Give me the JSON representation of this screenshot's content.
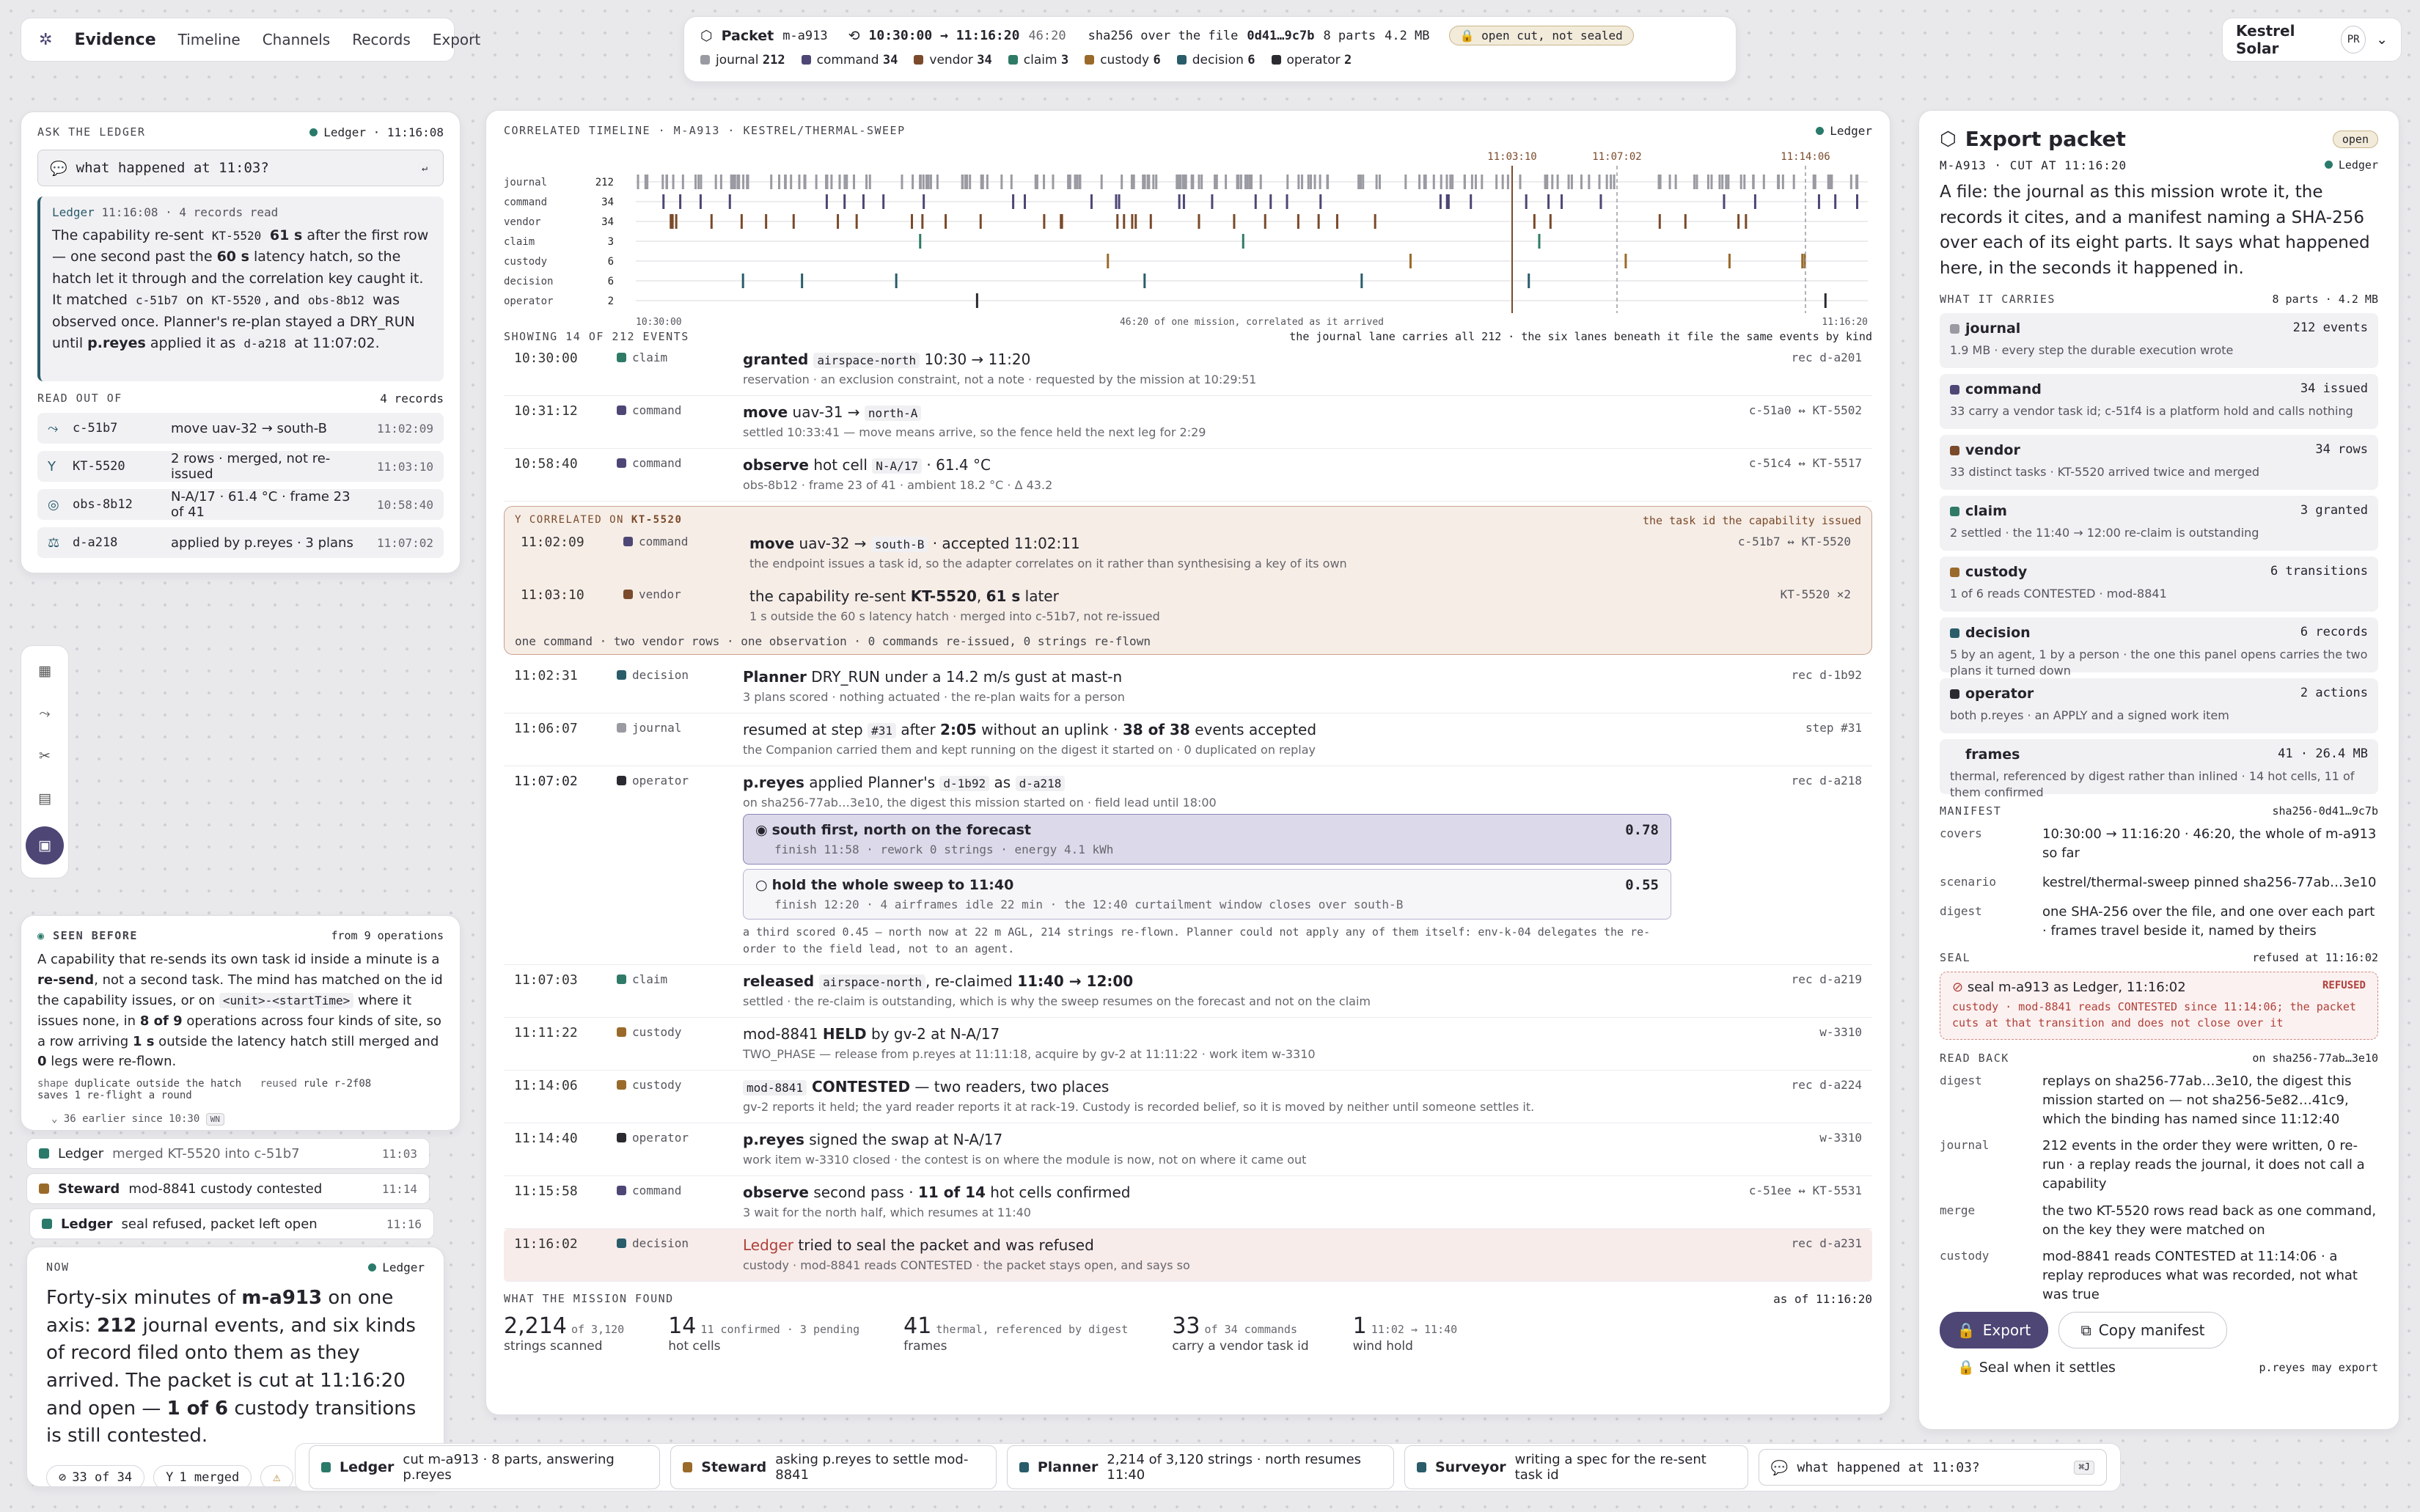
{
  "colors": {
    "journal": "#9a9aa2",
    "command": "#4e4675",
    "vendor": "#7a4a2a",
    "claim": "#2f7a66",
    "custody": "#9a6a2a",
    "decision": "#2a5c6a",
    "operator": "#2a2a30",
    "ledger": "#2a7a6a",
    "refused": "#b0403a"
  },
  "nav": {
    "brand": "Evidence",
    "items": [
      "Timeline",
      "Channels",
      "Records",
      "Export"
    ]
  },
  "packet": {
    "label": "Packet",
    "id": "m-a913",
    "range": "10:30:00 → 11:16:20",
    "dur": "46:20",
    "hash": "sha256 over the file",
    "hashval": "0d41…9c7b",
    "parts": "8 parts",
    "size": "4.2 MB",
    "badge": "open cut, not sealed",
    "counts": [
      {
        "k": "journal",
        "n": "212"
      },
      {
        "k": "command",
        "n": "34"
      },
      {
        "k": "vendor",
        "n": "34"
      },
      {
        "k": "claim",
        "n": "3"
      },
      {
        "k": "custody",
        "n": "6"
      },
      {
        "k": "decision",
        "n": "6"
      },
      {
        "k": "operator",
        "n": "2"
      }
    ]
  },
  "account": {
    "name": "Kestrel Solar",
    "initials": "PR"
  },
  "ask": {
    "title": "ASK THE LEDGER",
    "status": "Ledger · 11:16:08",
    "query": "what happened at 11:03?",
    "enter": "↵",
    "answer_meta_name": "Ledger",
    "answer_meta": "11:16:08 · 4 records read",
    "answer": [
      {
        "t": "The capability re-sent "
      },
      {
        "c": "KT-5520"
      },
      {
        "b": " 61 s"
      },
      {
        "t": " after the first row — one second past the "
      },
      {
        "b": "60 s"
      },
      {
        "t": " latency hatch, so the hatch let it through and the correlation key caught it. It matched "
      },
      {
        "c": "c-51b7"
      },
      {
        "t": " on "
      },
      {
        "c": "KT-5520"
      },
      {
        "t": ", and "
      },
      {
        "c": "obs-8b12"
      },
      {
        "t": " was observed once. Planner's re-plan stayed a DRY_RUN until "
      },
      {
        "b": "p.reyes"
      },
      {
        "t": " applied it as "
      },
      {
        "c": "d-a218"
      },
      {
        "t": " at 11:07:02."
      }
    ],
    "readout_title": "READ OUT OF",
    "readout_count": "4 records",
    "records": [
      {
        "icon": "⤳",
        "id": "c-51b7",
        "desc": "move uav-32 → south-B",
        "time": "11:02:09"
      },
      {
        "icon": "Y",
        "id": "KT-5520",
        "desc": "2 rows · merged, not re-issued",
        "time": "11:03:10"
      },
      {
        "icon": "◎",
        "id": "obs-8b12",
        "desc": "N-A/17 · 61.4 °C · frame 23 of 41",
        "time": "10:58:40"
      },
      {
        "icon": "⚖",
        "id": "d-a218",
        "desc": "applied by p.reyes · 3 plans",
        "time": "11:07:02"
      }
    ]
  },
  "seen": {
    "title": "SEEN BEFORE",
    "from": "from 9 operations",
    "body": [
      {
        "t": "A capability that re-sends its own task id inside a minute is a "
      },
      {
        "b": "re-send"
      },
      {
        "t": ", not a second task. The mind has matched on the id the capability issues, or on "
      },
      {
        "c": "<unit>-<startTime>"
      },
      {
        "t": " where it issues none, in "
      },
      {
        "b": "8 of 9"
      },
      {
        "t": " operations across four kinds of site, so a row arriving "
      },
      {
        "b": "1 s"
      },
      {
        "t": " outside the latency hatch still merged and "
      },
      {
        "b": "0"
      },
      {
        "t": " legs were re-flown."
      }
    ],
    "shape_k": "shape",
    "shape_v": "duplicate outside the hatch",
    "reused_k": "reused",
    "reused_v": "rule r-2f08",
    "saves": "saves 1 re-flight a round",
    "earlier": "36 earlier since 10:30",
    "earlier_key": "WN"
  },
  "stream": [
    {
      "name": "Ledger",
      "text": "merged KT-5520 into c-51b7",
      "time": "11:03",
      "color": "#2a7a6a"
    },
    {
      "name": "Steward",
      "text": "mod-8841 custody contested",
      "time": "11:14",
      "color": "#9a6a2a"
    },
    {
      "name": "Ledger",
      "text": "seal refused, packet left open",
      "time": "11:16",
      "color": "#2a7a6a"
    }
  ],
  "now": {
    "title": "NOW",
    "who": "Ledger",
    "body": [
      {
        "t": "Forty-six minutes of "
      },
      {
        "b": "m-a913"
      },
      {
        "t": " on one axis: "
      },
      {
        "b": "212"
      },
      {
        "t": " journal events, and six kinds of record filed onto them as they arrived. The packet is cut at 11:16:20 and open — "
      },
      {
        "b": "1 of 6"
      },
      {
        "t": " custody transitions is still contested."
      }
    ],
    "chips": [
      {
        "icon": "⊘",
        "text": "33 of 34"
      },
      {
        "icon": "Y",
        "text": "1 merged"
      },
      {
        "icon": "⚠",
        "text": ""
      }
    ]
  },
  "timeline": {
    "title": "CORRELATED TIMELINE · M-A913 · KESTREL/THERMAL-SWEEP",
    "status": "Ledger",
    "lanes": [
      {
        "k": "journal",
        "n": "212"
      },
      {
        "k": "command",
        "n": "34"
      },
      {
        "k": "vendor",
        "n": "34"
      },
      {
        "k": "claim",
        "n": "3"
      },
      {
        "k": "custody",
        "n": "6"
      },
      {
        "k": "decision",
        "n": "6"
      },
      {
        "k": "operator",
        "n": "2"
      }
    ],
    "markers": [
      "11:03:10",
      "11:07:02",
      "11:14:06"
    ],
    "start": "10:30:00",
    "end": "11:16:20",
    "caption": "46:20 of one mission, correlated as it arrived",
    "showing": "SHOWING 14 OF 212 EVENTS",
    "showing_note": "the journal lane carries all 212 · the six lanes beneath it file the same events by kind"
  },
  "events_a": [
    {
      "time": "10:30:00",
      "kind": "claim",
      "main": [
        {
          "b": "granted "
        },
        {
          "c": "airspace-north"
        },
        {
          "t": " 10:30 → 11:20"
        }
      ],
      "sub": "reservation · an exclusion constraint, not a note · requested by the mission at 10:29:51",
      "ref": "rec d-a201"
    },
    {
      "time": "10:31:12",
      "kind": "command",
      "main": [
        {
          "b": "move"
        },
        {
          "t": " uav-31 → "
        },
        {
          "c": "north-A"
        }
      ],
      "sub": "settled 10:33:41 — move means arrive, so the fence held the next leg for 2:29",
      "ref": "c-51a0 ↔ KT-5502"
    },
    {
      "time": "10:58:40",
      "kind": "command",
      "main": [
        {
          "b": "observe"
        },
        {
          "t": " hot cell "
        },
        {
          "c": "N-A/17"
        },
        {
          "t": " · 61.4 °C"
        }
      ],
      "sub": "obs-8b12 · frame 23 of 41 · ambient 18.2 °C · Δ 43.2",
      "ref": "c-51c4 ↔ KT-5517"
    }
  ],
  "corr": {
    "title": "CORRELATED ON",
    "key": "KT-5520",
    "note": "the task id the capability issued",
    "rows": [
      {
        "time": "11:02:09",
        "kind": "command",
        "main": [
          {
            "b": "move"
          },
          {
            "t": " uav-32 → "
          },
          {
            "c": "south-B"
          },
          {
            "t": " · accepted 11:02:11"
          }
        ],
        "sub": "the endpoint issues a task id, so the adapter correlates on it rather than synthesising a key of its own",
        "ref": "c-51b7 ↔ KT-5520"
      },
      {
        "time": "11:03:10",
        "kind": "vendor",
        "main": [
          {
            "t": "the capability re-sent "
          },
          {
            "b": "KT-5520"
          },
          {
            "t": ", "
          },
          {
            "b": "61 s"
          },
          {
            "t": " later"
          }
        ],
        "sub": "1 s outside the 60 s latency hatch · merged into c-51b7, not re-issued",
        "ref": "KT-5520 ×2"
      }
    ],
    "footer": "one command · two vendor rows · one observation · 0 commands re-issued, 0 strings re-flown"
  },
  "events_b": [
    {
      "time": "11:02:31",
      "kind": "decision",
      "main": [
        {
          "b": "Planner"
        },
        {
          "t": " DRY_RUN under a 14.2 m/s gust at mast-n"
        }
      ],
      "sub": "3 plans scored · nothing actuated · the re-plan waits for a person",
      "ref": "rec d-1b92"
    },
    {
      "time": "11:06:07",
      "kind": "journal",
      "main": [
        {
          "t": "resumed at step "
        },
        {
          "c": "#31"
        },
        {
          "t": " after "
        },
        {
          "b": "2:05"
        },
        {
          "t": " without an uplink · "
        },
        {
          "b": "38 of 38"
        },
        {
          "t": " events accepted"
        }
      ],
      "sub": "the Companion carried them and kept running on the digest it started on · 0 duplicated on replay",
      "ref": "step #31"
    }
  ],
  "op": {
    "time": "11:07:02",
    "kind": "operator",
    "main": [
      {
        "b": "p.reyes"
      },
      {
        "t": " applied Planner's "
      },
      {
        "c": "d-1b92"
      },
      {
        "t": " as "
      },
      {
        "c": "d-a218"
      }
    ],
    "sub": "on sha256-77ab…3e10, the digest this mission started on · field lead until 18:00",
    "ref": "rec d-a218",
    "opts": [
      {
        "title": "south first, north on the forecast",
        "detail": "finish 11:58 · rework 0 strings · energy 4.1 kWh",
        "score": "0.78"
      },
      {
        "title": "hold the whole sweep to 11:40",
        "detail": "finish 12:20 · 4 airframes idle 22 min · the 12:40 curtailment window closes over south-B",
        "score": "0.55"
      }
    ],
    "note": "a third scored 0.45 — north now at 22 m AGL, 214 strings re-flown. Planner could not apply any of them itself: env-k-04 delegates the re-order to the field lead, not to an agent."
  },
  "events_c": [
    {
      "time": "11:07:03",
      "kind": "claim",
      "main": [
        {
          "b": "released "
        },
        {
          "c": "airspace-north"
        },
        {
          "t": ", re-claimed "
        },
        {
          "b": "11:40 → 12:00"
        }
      ],
      "sub": "settled · the re-claim is outstanding, which is why the sweep resumes on the forecast and not on the claim",
      "ref": "rec d-a219"
    },
    {
      "time": "11:11:22",
      "kind": "custody",
      "main": [
        {
          "t": "mod-8841 "
        },
        {
          "b": "HELD"
        },
        {
          "t": " by gv-2 at N-A/17"
        }
      ],
      "sub": "TWO_PHASE — release from p.reyes at 11:11:18, acquire by gv-2 at 11:11:22 · work item w-3310",
      "ref": "w-3310"
    },
    {
      "time": "11:14:06",
      "kind": "custody",
      "main": [
        {
          "c": "mod-8841"
        },
        {
          "b": " CONTESTED"
        },
        {
          "t": " — two readers, two places"
        }
      ],
      "sub": "gv-2 reports it held; the yard reader reports it at rack-19. Custody is recorded belief, so it is moved by neither until someone settles it.",
      "ref": "rec d-a224"
    },
    {
      "time": "11:14:40",
      "kind": "operator",
      "main": [
        {
          "b": "p.reyes"
        },
        {
          "t": " signed the swap at N-A/17"
        }
      ],
      "sub": "work item w-3310 closed · the contest is on where the module is now, not on where it came out",
      "ref": "w-3310"
    },
    {
      "time": "11:15:58",
      "kind": "command",
      "main": [
        {
          "b": "observe"
        },
        {
          "t": " second pass · "
        },
        {
          "b": "11 of 14"
        },
        {
          "t": " hot cells confirmed"
        }
      ],
      "sub": "3 wait for the north half, which resumes at 11:40",
      "ref": "c-51ee ↔ KT-5531"
    }
  ],
  "refused_row": {
    "time": "11:16:02",
    "kind": "decision",
    "main": [
      {
        "r": "Ledger"
      },
      {
        "t": " tried to seal the packet and was refused"
      }
    ],
    "sub": "custody · mod-8841 reads CONTESTED · the packet stays open, and says so",
    "ref": "rec d-a231"
  },
  "found": {
    "title": "WHAT THE MISSION FOUND",
    "asof": "as of 11:16:20",
    "stats": [
      {
        "big": "2,214",
        "small": "of 3,120",
        "label": "strings scanned"
      },
      {
        "big": "14",
        "small": "11 confirmed · 3 pending",
        "label": "hot cells"
      },
      {
        "big": "41",
        "small": "thermal, referenced by digest",
        "label": "frames"
      },
      {
        "big": "33",
        "small": "of 34 commands",
        "label": "carry a vendor task id"
      },
      {
        "big": "1",
        "small": "11:02 → 11:40",
        "label": "wind hold"
      }
    ]
  },
  "export": {
    "title": "Export packet",
    "badge": "open",
    "sub": "M-A913 · CUT AT 11:16:20",
    "status": "Ledger",
    "lead": "A file: the journal as this mission wrote it, the records it cites, and a manifest naming a SHA-256 over each of its eight parts. It says what happened here, in the seconds it happened in.",
    "carries_title": "WHAT IT CARRIES",
    "carries_meta": "8 parts · 4.2 MB",
    "parts": [
      {
        "k": "journal",
        "n": "212 events",
        "d": "1.9 MB · every step the durable execution wrote"
      },
      {
        "k": "command",
        "n": "34 issued",
        "d": "33 carry a vendor task id; c-51f4 is a platform hold and calls nothing"
      },
      {
        "k": "vendor",
        "n": "34 rows",
        "d": "33 distinct tasks · KT-5520 arrived twice and merged"
      },
      {
        "k": "claim",
        "n": "3 granted",
        "d": "2 settled · the 11:40 → 12:00 re-claim is outstanding"
      },
      {
        "k": "custody",
        "n": "6 transitions",
        "d": "1 of 6 reads CONTESTED · mod-8841"
      },
      {
        "k": "decision",
        "n": "6 records",
        "d": "5 by an agent, 1 by a person · the one this panel opens carries the two plans it turned down"
      },
      {
        "k": "operator",
        "n": "2 actions",
        "d": "both p.reyes · an APPLY and a signed work item"
      },
      {
        "k": "frames",
        "n": "41 · 26.4 MB",
        "d": "thermal, referenced by digest rather than inlined · 14 hot cells, 11 of them confirmed"
      }
    ],
    "manifest_title": "MANIFEST",
    "manifest_hash": "sha256-0d41…9c7b",
    "manifest": [
      {
        "k": "covers",
        "v": "10:30:00 → 11:16:20 · 46:20, the whole of m-a913 so far"
      },
      {
        "k": "scenario",
        "v": "kestrel/thermal-sweep pinned sha256-77ab…3e10"
      },
      {
        "k": "digest",
        "v": "one SHA-256 over the file, and one over each part · frames travel beside it, named by theirs"
      }
    ],
    "seal_title": "SEAL",
    "seal_meta": "refused at 11:16:02",
    "seal_line": "seal m-a913 as Ledger, 11:16:02",
    "seal_tag": "REFUSED",
    "seal_detail": "custody · mod-8841 reads CONTESTED since 11:14:06; the packet cuts at that transition and does not close over it",
    "readback_title": "READ BACK",
    "readback_meta": "on sha256-77ab…3e10",
    "readback": [
      {
        "k": "digest",
        "v": "replays on sha256-77ab…3e10, the digest this mission started on — not sha256-5e82…41c9, which the binding has named since 11:12:40"
      },
      {
        "k": "journal",
        "v": "212 events in the order they were written, 0 re-run · a replay reads the journal, it does not call a capability"
      },
      {
        "k": "merge",
        "v": "the two KT-5520 rows read back as one command, on the key they were matched on"
      },
      {
        "k": "custody",
        "v": "mod-8841 reads CONTESTED at 11:14:06 · a replay reproduces what was recorded, not what was true"
      }
    ],
    "export_btn": "Export",
    "copy_btn": "Copy manifest",
    "seal_btn": "Seal when it settles",
    "may": "p.reyes may export"
  },
  "bottombar": {
    "agents": [
      {
        "name": "Ledger",
        "text": "cut m-a913 · 8 parts, answering p.reyes",
        "color": "#2a7a6a"
      },
      {
        "name": "Steward",
        "text": "asking p.reyes to settle mod-8841",
        "color": "#9a6a2a"
      },
      {
        "name": "Planner",
        "text": "2,214 of 3,120 strings · north resumes 11:40",
        "color": "#2a5c6a"
      },
      {
        "name": "Surveyor",
        "text": "writing a spec for the re-sent task id",
        "color": "#2a5c6a"
      }
    ],
    "query": "what happened at 11:03?",
    "key": "⌘J"
  }
}
